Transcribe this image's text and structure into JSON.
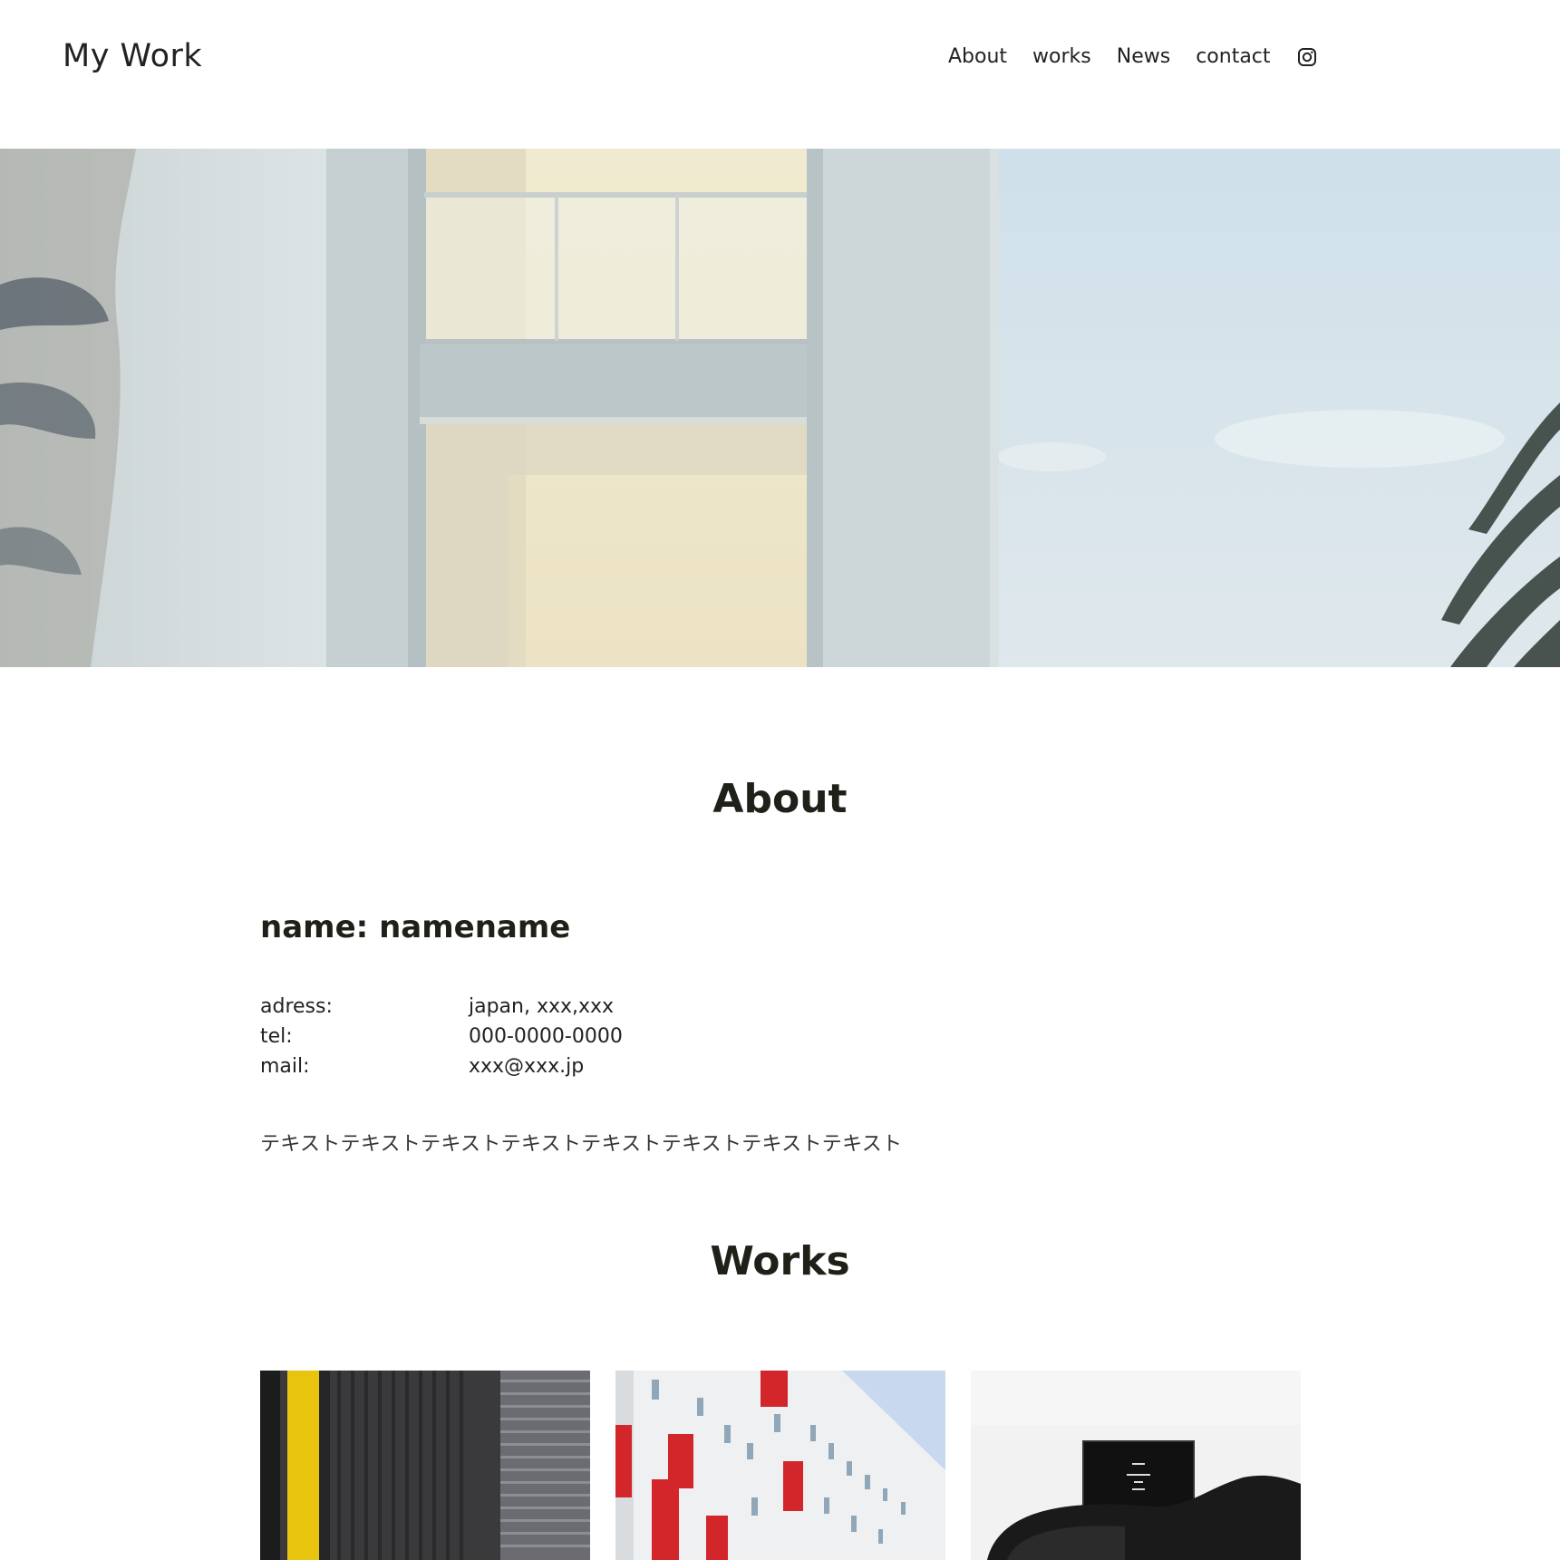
{
  "header": {
    "logo": "My Work",
    "nav": [
      {
        "label": "About"
      },
      {
        "label": "works"
      },
      {
        "label": "News"
      },
      {
        "label": "contact"
      }
    ],
    "social_icon": "instagram-icon"
  },
  "hero": {
    "image": "building-balcony-photo"
  },
  "about": {
    "title": "About",
    "name_line": "name: namename",
    "rows": [
      {
        "label": "adress:",
        "value": "japan, xxx,xxx"
      },
      {
        "label": "tel:",
        "value": "000-0000-0000"
      },
      {
        "label": "mail:",
        "value": "xxx@xxx.jp"
      }
    ],
    "bio": "テキストテキストテキストテキストテキストテキストテキストテキスト"
  },
  "works": {
    "title": "Works",
    "items": [
      {
        "image": "dark-facade-yellow-stripe-photo"
      },
      {
        "image": "white-building-red-panels-photo"
      },
      {
        "image": "letterboard-chair-photo"
      }
    ]
  },
  "colors": {
    "text": "#222222",
    "heading": "#1e2118",
    "background": "#ffffff"
  }
}
